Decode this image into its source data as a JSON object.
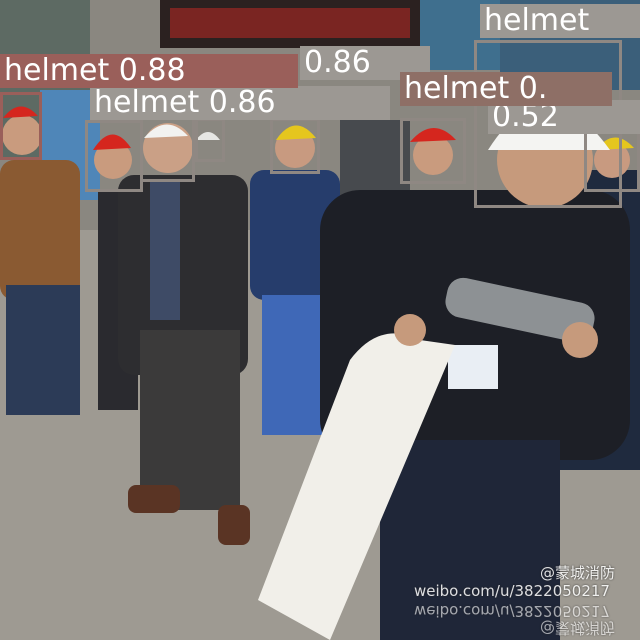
{
  "image": {
    "description": "Construction workers in safety helmets watching a man handle a fire hose, with object-detection boxes drawn on helmets."
  },
  "detections": [
    {
      "class_label": "helmet",
      "score_text": "0.88",
      "color": "#9a5f5a"
    },
    {
      "class_label": "",
      "score_text": "0.86",
      "color": "#9c9893"
    },
    {
      "class_label": "helmet",
      "score_text": "0.86",
      "color": "#9c9893"
    },
    {
      "class_label": "helmet",
      "score_text": "0.",
      "color": "#8e6f66"
    },
    {
      "class_label": "helmet",
      "score_text": "",
      "color": "#9c9893"
    },
    {
      "class_label": "",
      "score_text": "0.52",
      "color": "#9c9893"
    }
  ],
  "watermarks": {
    "handle": "@蒙城消防",
    "url": "weibo.com/u/3822050217"
  },
  "colors": {
    "box_red": "#9a5f5a",
    "box_gray": "#9c9893",
    "box_brown": "#8e6f66",
    "text": "#ffffff"
  }
}
